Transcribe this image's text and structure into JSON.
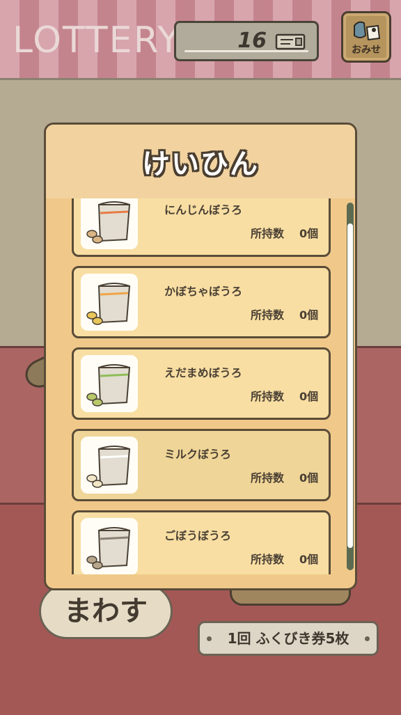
{
  "header": {
    "title": "LOTTERY",
    "ticket_count": "16",
    "shop_label": "おみせ"
  },
  "prize_modal": {
    "title": "けいひん",
    "items": [
      {
        "name": "にんじんぼうろ",
        "owned_label": "所持数",
        "owned_count": "0個",
        "accent_color": "#e87b43"
      },
      {
        "name": "かぼちゃぼうろ",
        "owned_label": "所持数",
        "owned_count": "0個",
        "accent_color": "#efa447"
      },
      {
        "name": "えだまめぼうろ",
        "owned_label": "所持数",
        "owned_count": "0個",
        "accent_color": "#8fbd5a"
      },
      {
        "name": "ミルクぼうろ",
        "owned_label": "所持数",
        "owned_count": "0個",
        "accent_color": "#ffffff"
      },
      {
        "name": "ごぼうぼうろ",
        "owned_label": "所持数",
        "owned_count": "0個",
        "accent_color": "#8a7f72"
      }
    ]
  },
  "controls": {
    "spin_label": "まわす",
    "cost_label": "1回 ふくびき券5枚"
  },
  "colors": {
    "panel": "#f0c98a",
    "card": "#f8dea3",
    "outline": "#5a4c38",
    "stripe_light": "#d8a5ad",
    "stripe_dark": "#c4848e"
  }
}
